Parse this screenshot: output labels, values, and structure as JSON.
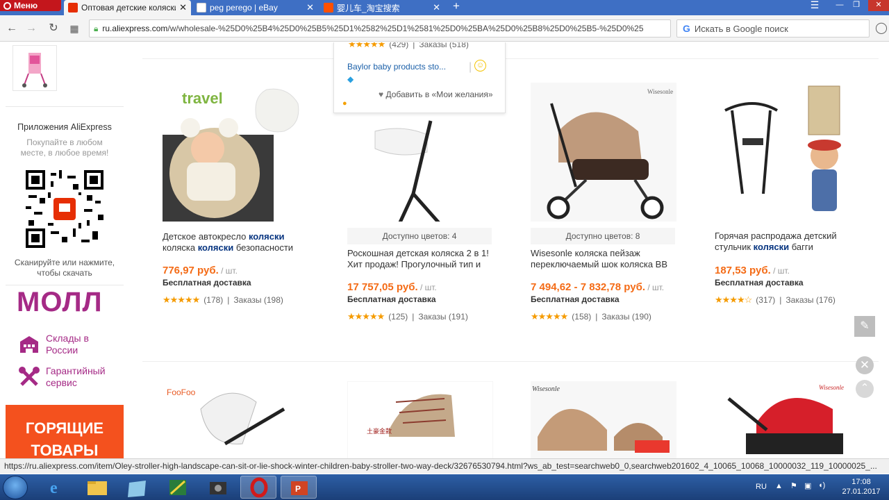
{
  "browser": {
    "menu_label": "Меню",
    "tabs": [
      {
        "title": "Оптовая детские коляски",
        "active": true,
        "favicon_color": "#e62e04"
      },
      {
        "title": "peg perego | eBay",
        "active": false,
        "favicon_color": "#e53238"
      },
      {
        "title": "婴儿车_淘宝搜索",
        "active": false,
        "favicon_color": "#ff5000"
      }
    ],
    "new_tab": "+",
    "url_host": "ru.aliexpress.com",
    "url_path": "/w/wholesale-%25D0%25B4%25D0%25B5%25D1%2582%25D1%2581%25D0%25BA%25D0%25B8%25D0%25B5-%25D0%25",
    "search_placeholder": "Искать в Google поиск",
    "status_url": "https://ru.aliexpress.com/item/Oley-stroller-high-landscape-can-sit-or-lie-shock-winter-children-baby-stroller-two-way-deck/32676530794.html?ws_ab_test=searchweb0_0,searchweb201602_4_10065_10068_10000032_119_10000025_..."
  },
  "sidebar": {
    "app_title": "Приложения AliExpress",
    "app_subtitle": "Покупайте в любом месте, в любое время!",
    "qr_caption": "Сканируйте или нажмите, чтобы скачать",
    "mall": "МОЛЛ",
    "links": [
      {
        "label": "Склады в России",
        "icon": "warehouse-icon"
      },
      {
        "label": "Гарантийный сервис",
        "icon": "tools-icon"
      }
    ],
    "hot_banner": "ГОРЯЩИЕ ТОВАРЫ"
  },
  "popup": {
    "rating_count": "(429)",
    "orders": "Заказы (518)",
    "store": "Baylor baby products sto...",
    "wishlist": "Добавить в «Мои желания»"
  },
  "products": [
    {
      "title_parts": [
        "Детское автокресло ",
        "коляски",
        " коляска ",
        "коляски",
        " безопасности"
      ],
      "colors": "",
      "price": "776,97 руб.",
      "unit": " / шт.",
      "shipping": "Бесплатная доставка",
      "reviews": "(178)",
      "orders": "Заказы (198)",
      "stars": 5
    },
    {
      "title_parts": [
        "Роскошная детская коляска 2 в 1! Хит продаж! Прогулочный тип и",
        "",
        "",
        "",
        ""
      ],
      "colors": "Доступно цветов: 4",
      "price": "17 757,05 руб.",
      "unit": " / шт.",
      "shipping": "Бесплатная доставка",
      "reviews": "(125)",
      "orders": "Заказы (191)",
      "stars": 5
    },
    {
      "title_parts": [
        "Wisesonle коляска пейзаж переключаемый шок коляска BB",
        "",
        "",
        "",
        ""
      ],
      "colors": "Доступно цветов: 8",
      "price": "7 494,62 - 7 832,78 руб.",
      "unit": " / шт.",
      "shipping": "Бесплатная доставка",
      "reviews": "(158)",
      "orders": "Заказы (190)",
      "stars": 5
    },
    {
      "title_parts": [
        "Горячая распродажа детский стульчик ",
        "коляски",
        " багги",
        "",
        ""
      ],
      "colors": "",
      "price": "187,53 руб.",
      "unit": " / шт.",
      "shipping": "Бесплатная доставка",
      "reviews": "(317)",
      "orders": "Заказы (176)",
      "stars": 4.5
    }
  ],
  "image_texts": {
    "travel": "travel",
    "wisesonle": "Wisesonle",
    "foofoo": "FooFoo",
    "chinese_label": "土豪金款"
  },
  "taskbar": {
    "lang": "RU",
    "time": "17:08",
    "date": "27.01.2017"
  }
}
